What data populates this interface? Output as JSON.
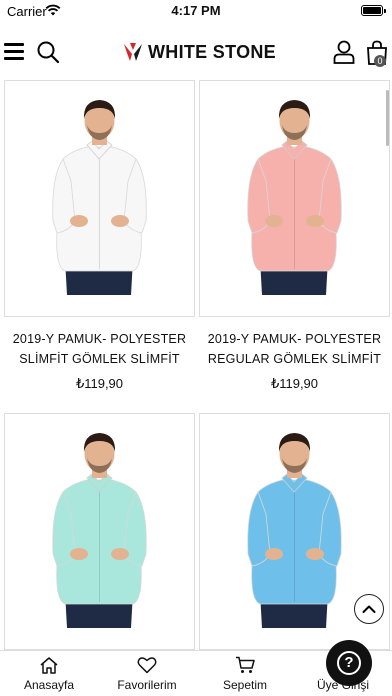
{
  "status_bar": {
    "carrier": "Carrier",
    "time": "4:17 PM"
  },
  "header": {
    "brand": "WHITE STONE",
    "cart_count": "0"
  },
  "products": [
    {
      "title_line1": "2019-Y  PAMUK- POLYESTER",
      "title_line2": "SLİMFİT GÖMLEK SLİMFİT",
      "price": "₺119,90",
      "shirt_color": "#f7f7f7"
    },
    {
      "title_line1": "2019-Y  PAMUK- POLYESTER",
      "title_line2": "REGULAR GÖMLEK SLİMFİT",
      "price": "₺119,90",
      "shirt_color": "#f6b1ad"
    },
    {
      "title_line1": "",
      "title_line2": "",
      "price": "",
      "shirt_color": "#a9e6dc"
    },
    {
      "title_line1": "",
      "title_line2": "",
      "price": "",
      "shirt_color": "#6ec0ea"
    }
  ],
  "tabbar": {
    "items": [
      {
        "label": "Anasayfa",
        "icon": "home-icon"
      },
      {
        "label": "Favorilerim",
        "icon": "heart-icon"
      },
      {
        "label": "Sepetim",
        "icon": "cart-icon"
      },
      {
        "label": "Üye Girişi",
        "icon": "user-icon"
      }
    ]
  },
  "help": {
    "symbol": "?"
  },
  "colors": {
    "logo_red": "#d6262b",
    "logo_dark": "#1a1a1a",
    "pants": "#1f2b44",
    "skin": "#e3b391",
    "hair": "#2a1c14"
  }
}
